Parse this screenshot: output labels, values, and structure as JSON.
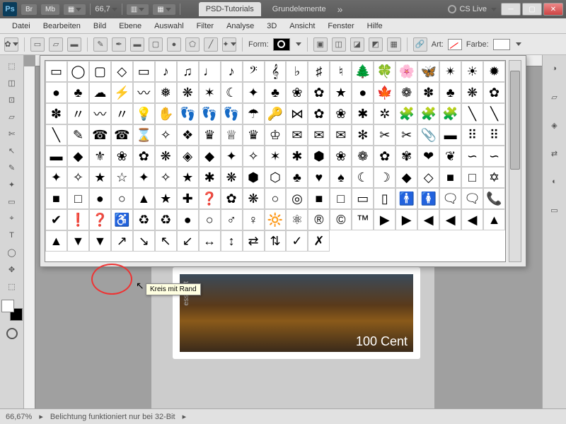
{
  "title": {
    "app_abbr": "Ps",
    "buttons": [
      "Br",
      "Mb"
    ],
    "zoom": "66,7",
    "tab_active": "PSD-Tutorials",
    "tab_inactive": "Grundelemente",
    "cslive": "CS Live"
  },
  "menu": [
    "Datei",
    "Bearbeiten",
    "Bild",
    "Ebene",
    "Auswahl",
    "Filter",
    "Analyse",
    "3D",
    "Ansicht",
    "Fenster",
    "Hilfe"
  ],
  "options": {
    "form_label": "Form:",
    "art_label": "Art:",
    "farbe_label": "Farbe:"
  },
  "popup": {
    "tooltip": "Kreis mit Rand",
    "shapes": [
      "▭",
      "◯",
      "▢",
      "◇",
      "▭",
      "♪",
      "♫",
      "♩",
      "♪",
      "𝄢",
      "𝄞",
      "♭",
      "♯",
      "♮",
      "🌲",
      "🍀",
      "🌸",
      "🦋",
      "✴",
      "☀",
      "✹",
      "●",
      "♣",
      "☁",
      "⚡",
      "〰",
      "❅",
      "❋",
      "✶",
      "☾",
      "✦",
      "♣",
      "❀",
      "✿",
      "★",
      "●",
      "🍁",
      "❁",
      "✽",
      "♣",
      "❋",
      "✿",
      "✽",
      "〃",
      "〰",
      "〃",
      "💡",
      "✋",
      "👣",
      "👣",
      "👣",
      "☂",
      "🔑",
      "⋈",
      "✿",
      "❀",
      "✱",
      "✲",
      "🧩",
      "🧩",
      "🧩",
      "╲",
      "╲",
      "╲",
      "✎",
      "☎",
      "☎",
      "⌛",
      "✧",
      "❖",
      "♛",
      "♕",
      "♛",
      "♔",
      "✉",
      "✉",
      "✉",
      "✻",
      "✂",
      "✂",
      "📎",
      "▬",
      "⠿",
      "⠿",
      "▬",
      "◆",
      "⚜",
      "❀",
      "✿",
      "❋",
      "◈",
      "◆",
      "✦",
      "✧",
      "✶",
      "✱",
      "⬢",
      "❀",
      "❁",
      "✿",
      "✾",
      "❤",
      "❦",
      "∽",
      "∽",
      "✦",
      "✧",
      "★",
      "☆",
      "✦",
      "✧",
      "★",
      "✱",
      "❋",
      "⬢",
      "⬡",
      "♣",
      "♥",
      "♠",
      "☾",
      "☽",
      "◆",
      "◇",
      "■",
      "□",
      "✡",
      "■",
      "□",
      "●",
      "○",
      "▲",
      "★",
      "✚",
      "❓",
      "✿",
      "❋",
      "○",
      "◎",
      "■",
      "□",
      "▭",
      "▯",
      "🚹",
      "🚺",
      "🗨",
      "🗨",
      "📞",
      "✔",
      "❗",
      "❓",
      "♿",
      "♻",
      "♻",
      "●",
      "○",
      "♂",
      "♀",
      "🔆",
      "⚛",
      "®",
      "©",
      "™",
      "▶",
      "▶",
      "◀",
      "◀",
      "◀",
      "▲",
      "▲",
      "▼",
      "▼",
      "↗",
      "↘",
      "↖",
      "↙",
      "↔",
      "↕",
      "⇄",
      "⇅",
      "✓",
      "✗"
    ]
  },
  "stamp": {
    "value_text": "100 Cent",
    "side_text": "esspost"
  },
  "status": {
    "zoom": "66,67%",
    "info": "Belichtung funktioniert nur bei 32-Bit"
  },
  "tools_left": [
    "⬚",
    "◫",
    "⊡",
    "▱",
    "✄",
    "↖",
    "✎",
    "✦",
    "▭",
    "⌖",
    "T",
    "◯",
    "✥",
    "⬚"
  ],
  "tools_right": [
    "◑",
    "▱",
    "◈",
    "⇄",
    "◐",
    "▭"
  ]
}
